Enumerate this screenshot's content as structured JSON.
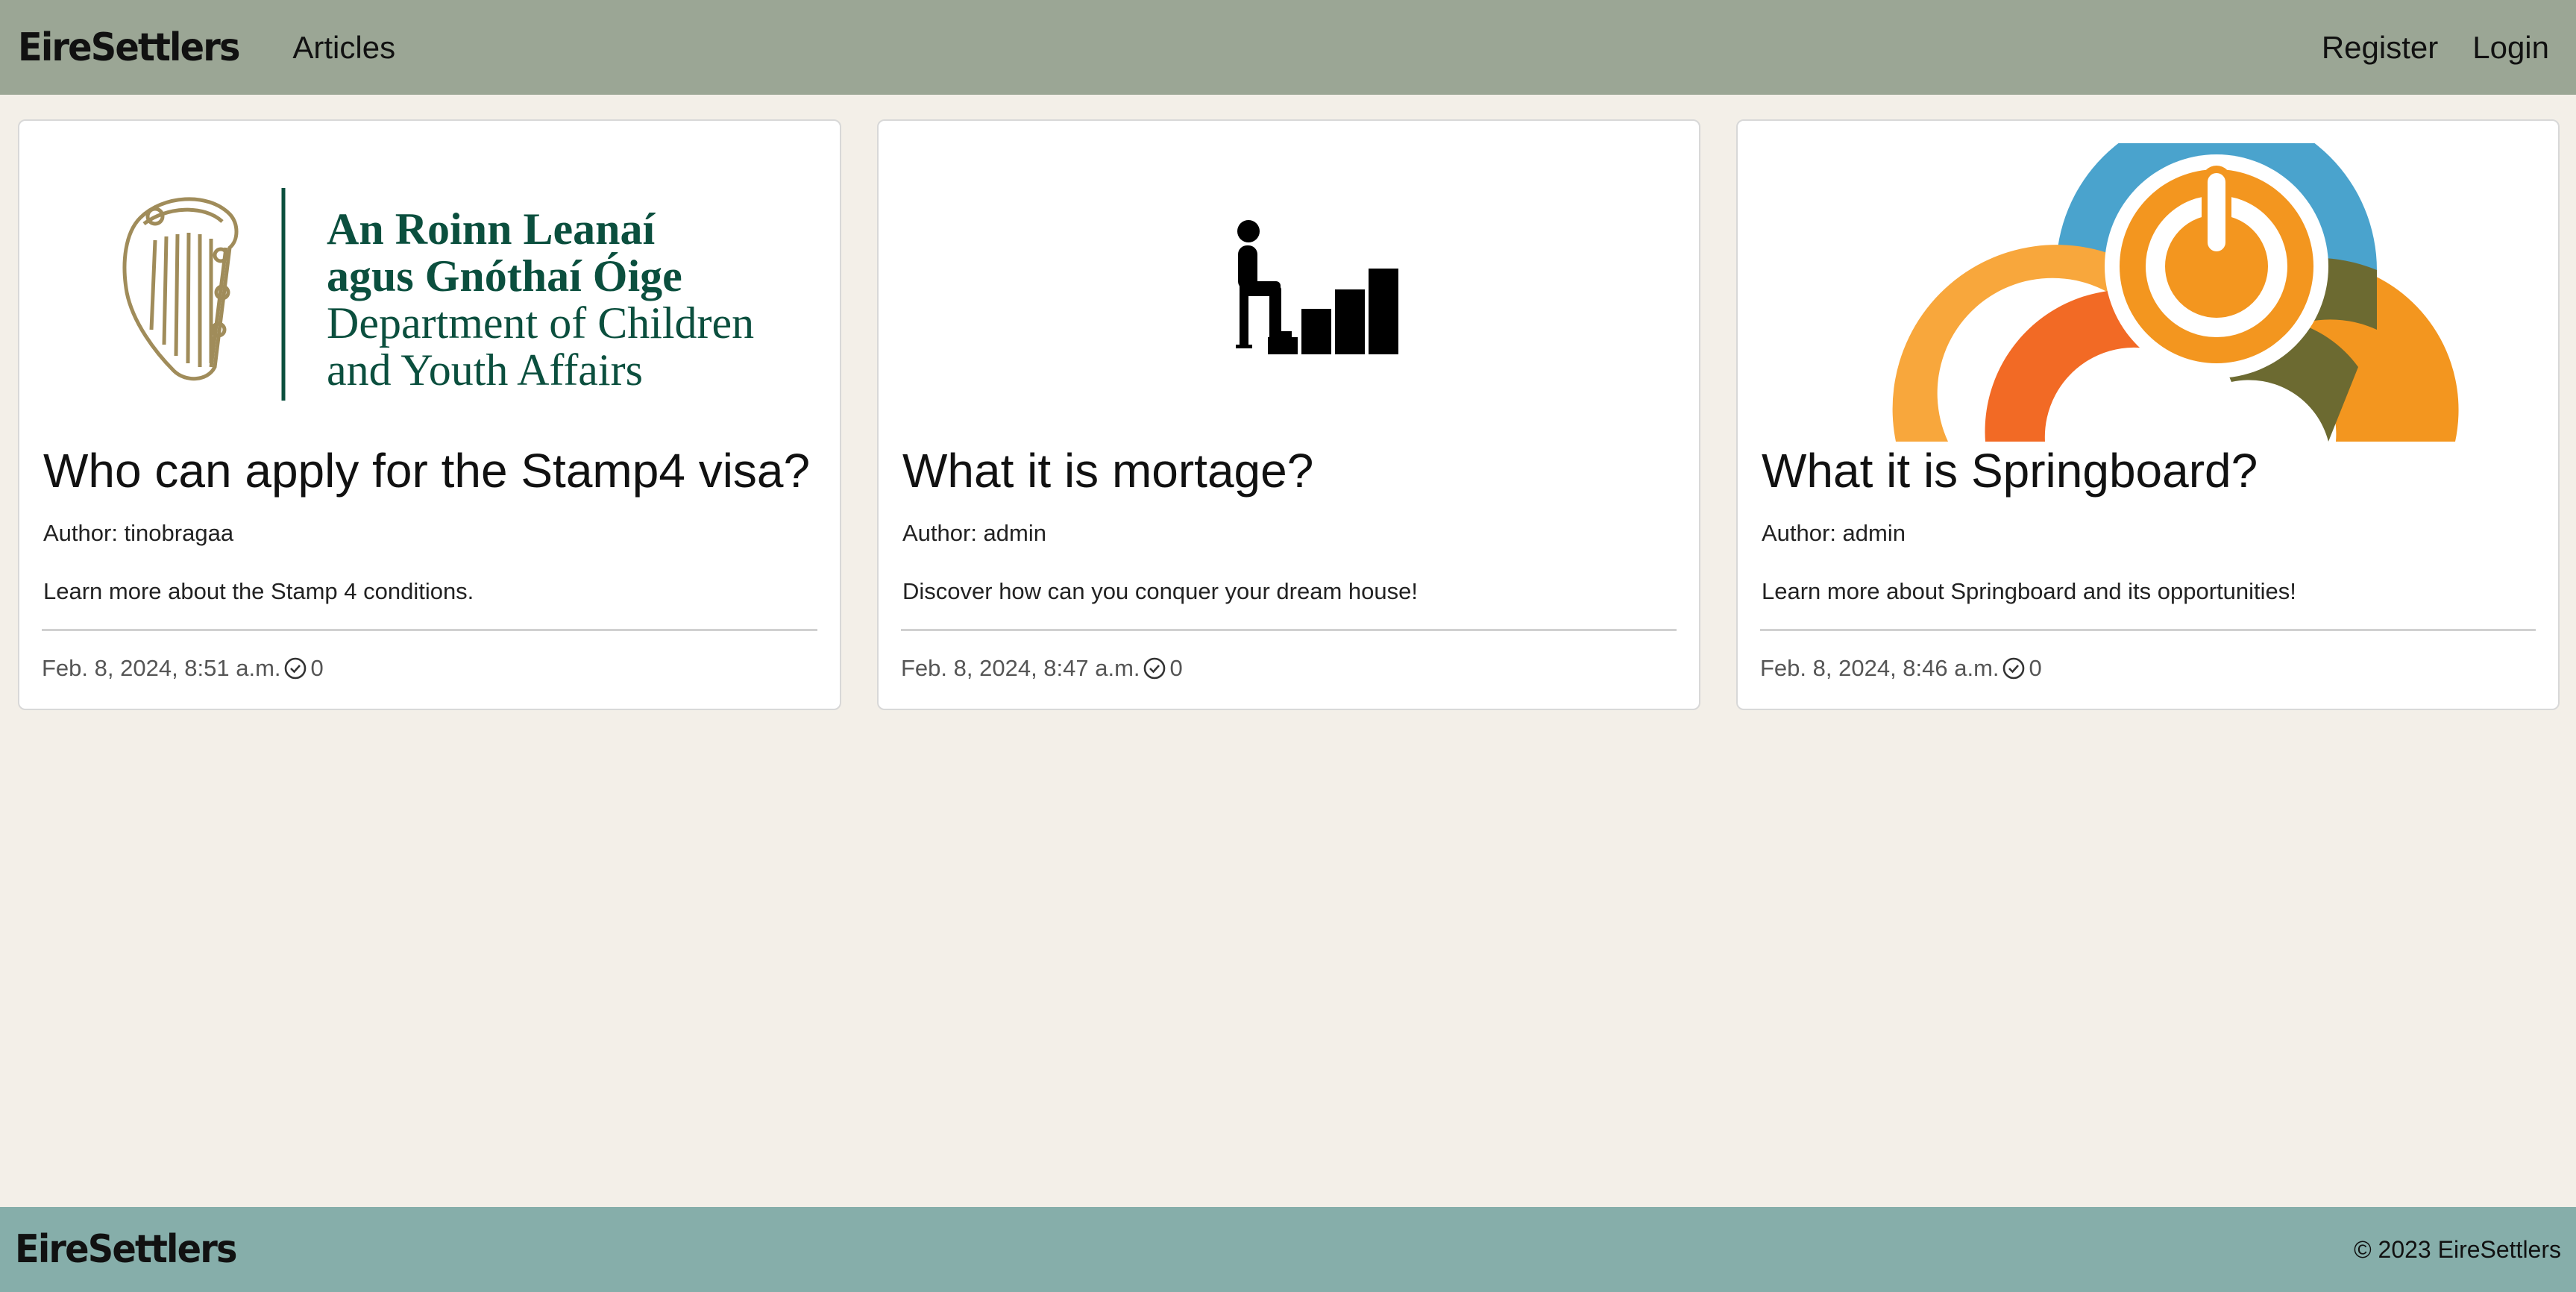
{
  "navbar": {
    "brand": "EireSettlers",
    "articles_label": "Articles",
    "register_label": "Register",
    "login_label": "Login"
  },
  "department_logo": {
    "line1": "An Roinn Leanaí",
    "line2": "agus Gnóthaí Óige",
    "line3": "Department of Children",
    "line4": "and Youth Affairs"
  },
  "articles": [
    {
      "title": "Who can apply for the Stamp4 visa?",
      "author": "Author: tinobragaa",
      "excerpt": "Learn more about the Stamp 4 conditions.",
      "date": "Feb. 8, 2024, 8:51 a.m.",
      "count": "0",
      "image_icon": "department-children-logo"
    },
    {
      "title": "What it is mortage?",
      "author": "Author: admin",
      "excerpt": "Discover how can you conquer your dream house!",
      "date": "Feb. 8, 2024, 8:47 a.m.",
      "count": "0",
      "image_icon": "person-bar-chart-icon"
    },
    {
      "title": "What it is Springboard?",
      "author": "Author: admin",
      "excerpt": "Learn more about Springboard and its opportunities!",
      "date": "Feb. 8, 2024, 8:46 a.m.",
      "count": "0",
      "image_icon": "springboard-logo"
    }
  ],
  "footer": {
    "brand": "EireSettlers",
    "copyright": "© 2023 EireSettlers"
  },
  "colors": {
    "navbar_bg": "#9ba695",
    "page_bg": "#f3efe8",
    "footer_bg": "#86aeaa",
    "department_green": "#0b4f3e",
    "harp_gold": "#a08c5a"
  }
}
